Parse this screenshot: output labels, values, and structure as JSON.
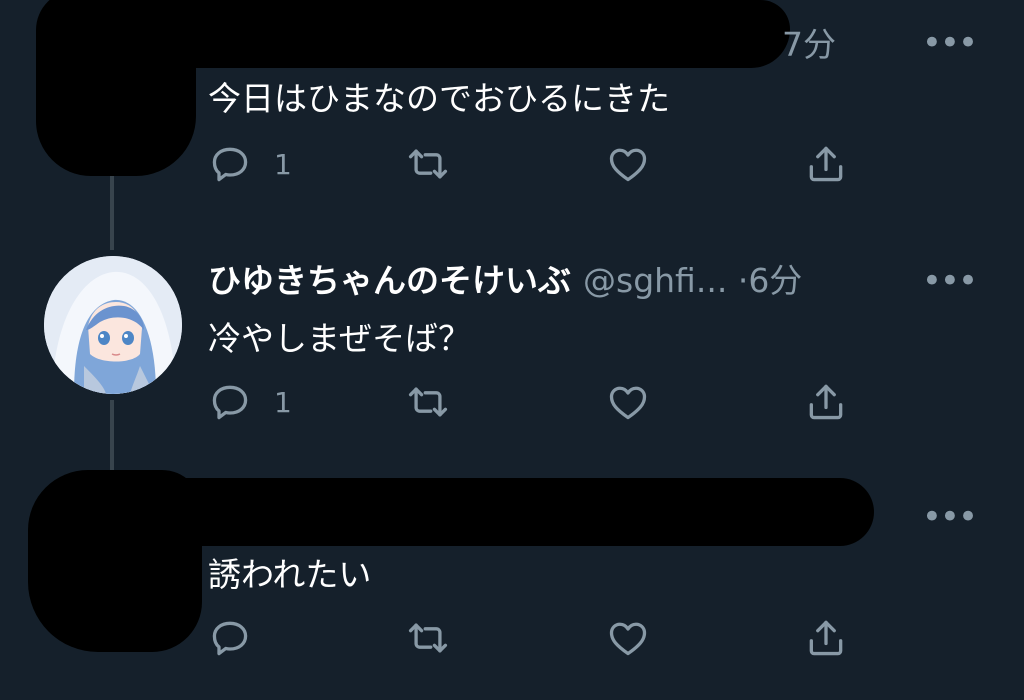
{
  "colors": {
    "background": "#15202b",
    "text_primary": "#ffffff",
    "text_secondary": "#8899a6",
    "thread_line": "#38444d",
    "redaction": "#000000"
  },
  "tweets": [
    {
      "time": "7分",
      "text": "今日はひまなのでおひるにきた",
      "reply_count": "1",
      "icons": [
        "reply-icon",
        "retweet-icon",
        "like-icon",
        "share-icon",
        "more-icon"
      ]
    },
    {
      "display_name": "ひゆきちゃんのそけいぶ",
      "handle": "@sghfi...",
      "separator": "·",
      "time": "6分",
      "text": "冷やしまぜそば？",
      "reply_count": "1",
      "icons": [
        "reply-icon",
        "retweet-icon",
        "like-icon",
        "share-icon",
        "more-icon"
      ]
    },
    {
      "text": "誘われたい",
      "icons": [
        "reply-icon",
        "retweet-icon",
        "like-icon",
        "share-icon",
        "more-icon"
      ]
    }
  ],
  "more_glyph": "•••"
}
